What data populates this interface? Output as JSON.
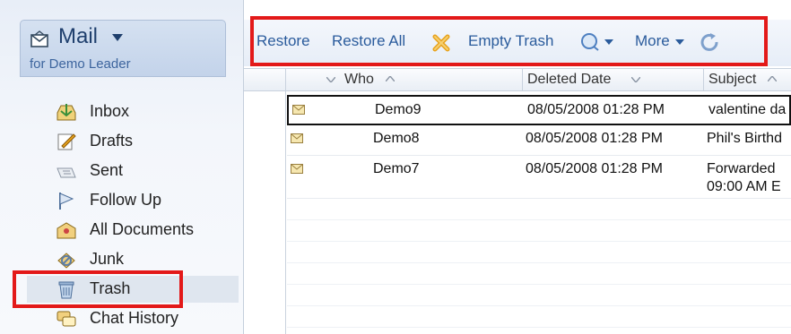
{
  "mail": {
    "title": "Mail",
    "subtitle": "for Demo Leader"
  },
  "nav": [
    {
      "label": "Inbox",
      "icon": "inbox-icon"
    },
    {
      "label": "Drafts",
      "icon": "drafts-icon"
    },
    {
      "label": "Sent",
      "icon": "sent-icon"
    },
    {
      "label": "Follow Up",
      "icon": "follow-up-flag-icon"
    },
    {
      "label": "All Documents",
      "icon": "all-documents-icon"
    },
    {
      "label": "Junk",
      "icon": "junk-icon"
    },
    {
      "label": "Trash",
      "icon": "trash-icon",
      "selected": true
    },
    {
      "label": "Chat History",
      "icon": "chat-history-icon"
    }
  ],
  "toolbar": {
    "restore": "Restore",
    "restore_all": "Restore All",
    "empty_trash": "Empty Trash",
    "more": "More"
  },
  "grid": {
    "columns": {
      "who": "Who",
      "deleted_date": "Deleted Date",
      "subject": "Subject"
    },
    "rows": [
      {
        "who": "Demo9",
        "date": "08/05/2008 01:28 PM",
        "subject": "valentine da"
      },
      {
        "who": "Demo8",
        "date": "08/05/2008 01:28 PM",
        "subject": "Phil's Birthd"
      },
      {
        "who": "Demo7",
        "date": "08/05/2008 01:28 PM",
        "subject": "Forwarded",
        "subject_line2": "09:00 AM E"
      }
    ]
  },
  "colors": {
    "highlight": "#e31919",
    "link": "#2a5b9c",
    "sidebar_bg": "#f3f6fb"
  }
}
